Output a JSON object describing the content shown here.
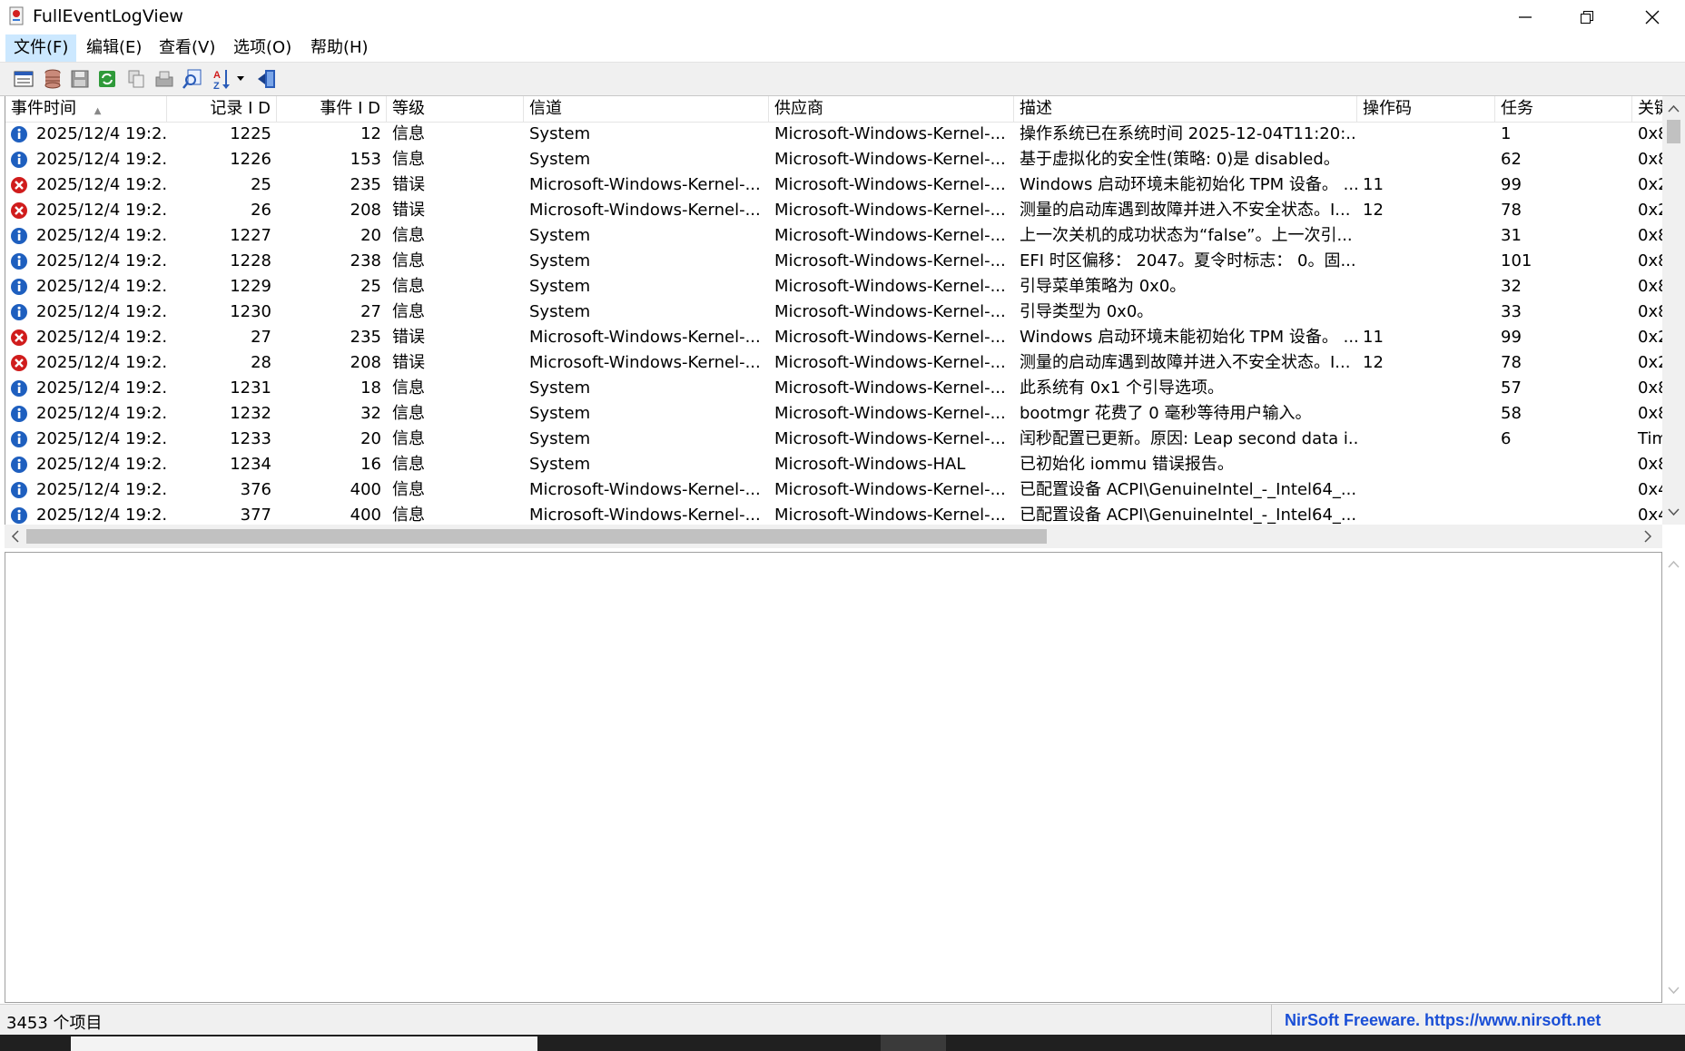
{
  "window": {
    "title": "FullEventLogView"
  },
  "menu": [
    {
      "label": "文件(F)"
    },
    {
      "label": "编辑(E)"
    },
    {
      "label": "查看(V)"
    },
    {
      "label": "选项(O)"
    },
    {
      "label": "帮助(H)"
    }
  ],
  "toolbar_icons": [
    "properties-icon",
    "data-source-icon",
    "save-icon",
    "refresh-icon",
    "copy-icon",
    "export-icon",
    "find-icon",
    "sort-icon",
    "exit-icon"
  ],
  "columns": [
    {
      "label": "事件时间"
    },
    {
      "label": "记录 I D"
    },
    {
      "label": "事件 I D"
    },
    {
      "label": "等级"
    },
    {
      "label": "信道"
    },
    {
      "label": "供应商"
    },
    {
      "label": "描述"
    },
    {
      "label": "操作码"
    },
    {
      "label": "任务"
    },
    {
      "label": "关键"
    }
  ],
  "rows": [
    {
      "type": "info",
      "time": "2025/12/4 19:2...",
      "record_id": "1225",
      "event_id": "12",
      "level": "信息",
      "channel": "System",
      "provider": "Microsoft-Windows-Kernel-...",
      "description": "操作系统已在系统时间 2025-12-04T11:20:...",
      "opcode": "",
      "task": "1",
      "keywords": "0x8"
    },
    {
      "type": "info",
      "time": "2025/12/4 19:2...",
      "record_id": "1226",
      "event_id": "153",
      "level": "信息",
      "channel": "System",
      "provider": "Microsoft-Windows-Kernel-...",
      "description": "基于虚拟化的安全性(策略: 0)是 disabled。",
      "opcode": "",
      "task": "62",
      "keywords": "0x8"
    },
    {
      "type": "error",
      "time": "2025/12/4 19:2...",
      "record_id": "25",
      "event_id": "235",
      "level": "错误",
      "channel": "Microsoft-Windows-Kernel-...",
      "provider": "Microsoft-Windows-Kernel-...",
      "description": "Windows 启动环境未能初始化 TPM 设备。 ...",
      "opcode": "11",
      "task": "99",
      "keywords": "0x2"
    },
    {
      "type": "error",
      "time": "2025/12/4 19:2...",
      "record_id": "26",
      "event_id": "208",
      "level": "错误",
      "channel": "Microsoft-Windows-Kernel-...",
      "provider": "Microsoft-Windows-Kernel-...",
      "description": "测量的启动库遇到故障并进入不安全状态。I...",
      "opcode": "12",
      "task": "78",
      "keywords": "0x2"
    },
    {
      "type": "info",
      "time": "2025/12/4 19:2...",
      "record_id": "1227",
      "event_id": "20",
      "level": "信息",
      "channel": "System",
      "provider": "Microsoft-Windows-Kernel-...",
      "description": "上一次关机的成功状态为“false”。上一次引...",
      "opcode": "",
      "task": "31",
      "keywords": "0x8"
    },
    {
      "type": "info",
      "time": "2025/12/4 19:2...",
      "record_id": "1228",
      "event_id": "238",
      "level": "信息",
      "channel": "System",
      "provider": "Microsoft-Windows-Kernel-...",
      "description": "EFI 时区偏移： 2047。夏令时标志： 0。固...",
      "opcode": "",
      "task": "101",
      "keywords": "0x8"
    },
    {
      "type": "info",
      "time": "2025/12/4 19:2...",
      "record_id": "1229",
      "event_id": "25",
      "level": "信息",
      "channel": "System",
      "provider": "Microsoft-Windows-Kernel-...",
      "description": "引导菜单策略为 0x0。",
      "opcode": "",
      "task": "32",
      "keywords": "0x8"
    },
    {
      "type": "info",
      "time": "2025/12/4 19:2...",
      "record_id": "1230",
      "event_id": "27",
      "level": "信息",
      "channel": "System",
      "provider": "Microsoft-Windows-Kernel-...",
      "description": "引导类型为 0x0。",
      "opcode": "",
      "task": "33",
      "keywords": "0x8"
    },
    {
      "type": "error",
      "time": "2025/12/4 19:2...",
      "record_id": "27",
      "event_id": "235",
      "level": "错误",
      "channel": "Microsoft-Windows-Kernel-...",
      "provider": "Microsoft-Windows-Kernel-...",
      "description": "Windows 启动环境未能初始化 TPM 设备。 ...",
      "opcode": "11",
      "task": "99",
      "keywords": "0x2"
    },
    {
      "type": "error",
      "time": "2025/12/4 19:2...",
      "record_id": "28",
      "event_id": "208",
      "level": "错误",
      "channel": "Microsoft-Windows-Kernel-...",
      "provider": "Microsoft-Windows-Kernel-...",
      "description": "测量的启动库遇到故障并进入不安全状态。I...",
      "opcode": "12",
      "task": "78",
      "keywords": "0x2"
    },
    {
      "type": "info",
      "time": "2025/12/4 19:2...",
      "record_id": "1231",
      "event_id": "18",
      "level": "信息",
      "channel": "System",
      "provider": "Microsoft-Windows-Kernel-...",
      "description": "此系统有 0x1 个引导选项。",
      "opcode": "",
      "task": "57",
      "keywords": "0x8"
    },
    {
      "type": "info",
      "time": "2025/12/4 19:2...",
      "record_id": "1232",
      "event_id": "32",
      "level": "信息",
      "channel": "System",
      "provider": "Microsoft-Windows-Kernel-...",
      "description": "bootmgr 花费了 0 毫秒等待用户输入。",
      "opcode": "",
      "task": "58",
      "keywords": "0x8"
    },
    {
      "type": "info",
      "time": "2025/12/4 19:2...",
      "record_id": "1233",
      "event_id": "20",
      "level": "信息",
      "channel": "System",
      "provider": "Microsoft-Windows-Kernel-...",
      "description": "闰秒配置已更新。原因: Leap second data i...",
      "opcode": "",
      "task": "6",
      "keywords": "Tim"
    },
    {
      "type": "info",
      "time": "2025/12/4 19:2...",
      "record_id": "1234",
      "event_id": "16",
      "level": "信息",
      "channel": "System",
      "provider": "Microsoft-Windows-HAL",
      "description": "已初始化 iommu 错误报告。",
      "opcode": "",
      "task": "",
      "keywords": "0x8"
    },
    {
      "type": "info",
      "time": "2025/12/4 19:2...",
      "record_id": "376",
      "event_id": "400",
      "level": "信息",
      "channel": "Microsoft-Windows-Kernel-...",
      "provider": "Microsoft-Windows-Kernel-...",
      "description": "已配置设备 ACPI\\GenuineIntel_-_Intel64_...",
      "opcode": "",
      "task": "",
      "keywords": "0x4"
    },
    {
      "type": "info",
      "time": "2025/12/4 19:2...",
      "record_id": "377",
      "event_id": "400",
      "level": "信息",
      "channel": "Microsoft-Windows-Kernel-...",
      "provider": "Microsoft-Windows-Kernel-...",
      "description": "已配置设备 ACPI\\GenuineIntel_-_Intel64_...",
      "opcode": "",
      "task": "",
      "keywords": "0x4"
    }
  ],
  "status": {
    "count": "3453 个项目",
    "link": "NirSoft Freeware. https://www.nirsoft.net"
  },
  "colors": {
    "link": "#1a4fd6",
    "selected_menu": "#cce8ff",
    "error": "#d01c1c",
    "info": "#1e5fbf"
  }
}
